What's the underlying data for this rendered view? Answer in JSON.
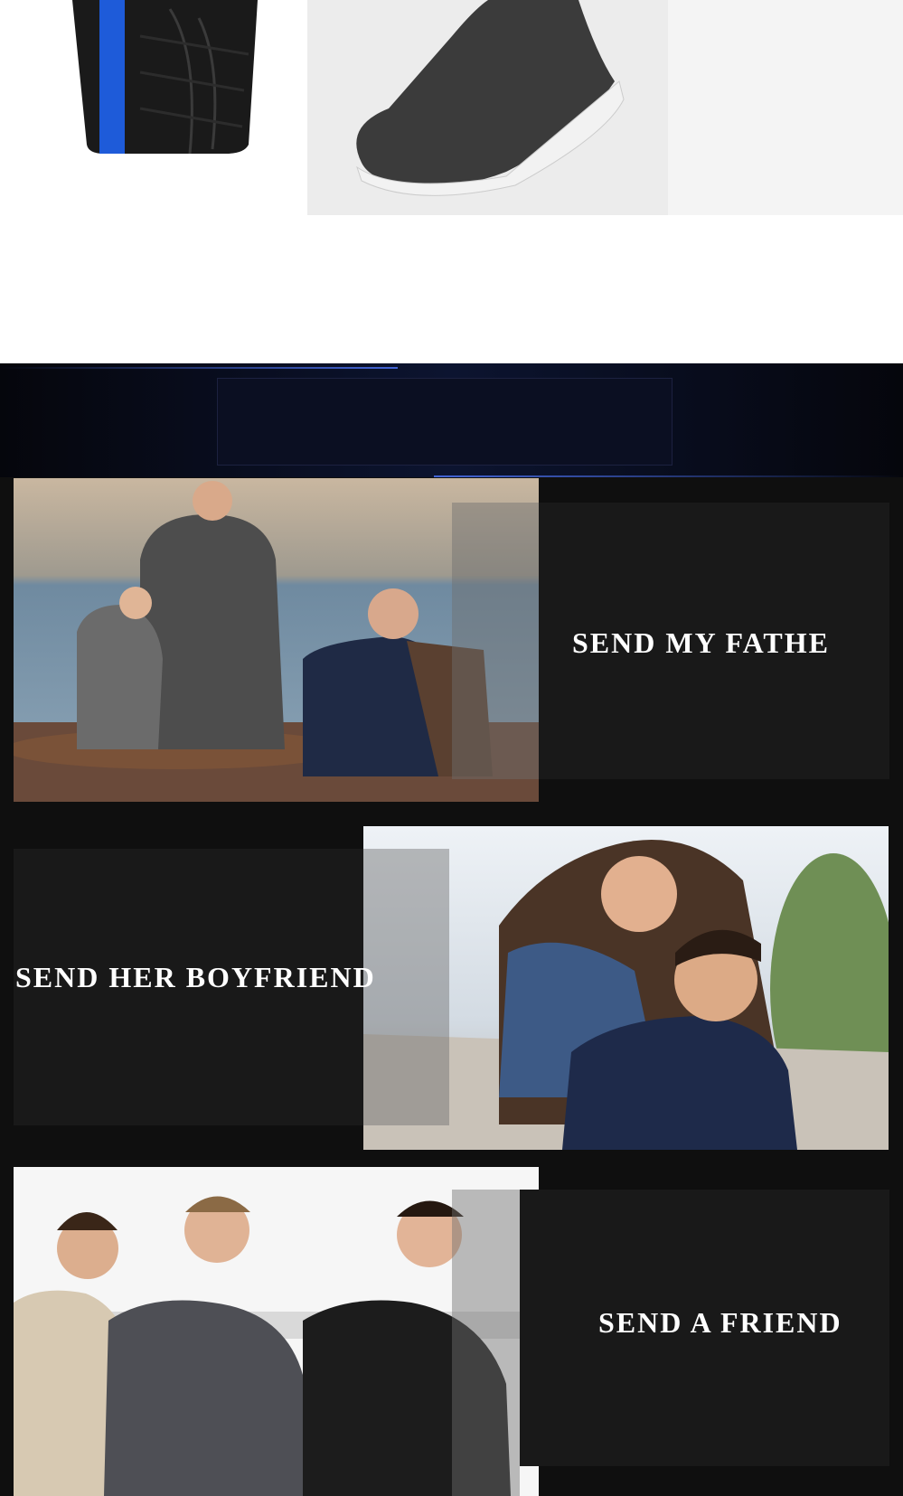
{
  "sections": {
    "father": {
      "caption": "SEND  MY  FATHE"
    },
    "boyfriend": {
      "caption": "SEND  HER BOYFRIEND"
    },
    "friend": {
      "caption": "SEND  A FRIEND"
    }
  },
  "colors": {
    "background_dark": "#0f0f0f",
    "panel": "#191919",
    "banner_glow": "#4d6cff",
    "caption": "#ffffff"
  }
}
